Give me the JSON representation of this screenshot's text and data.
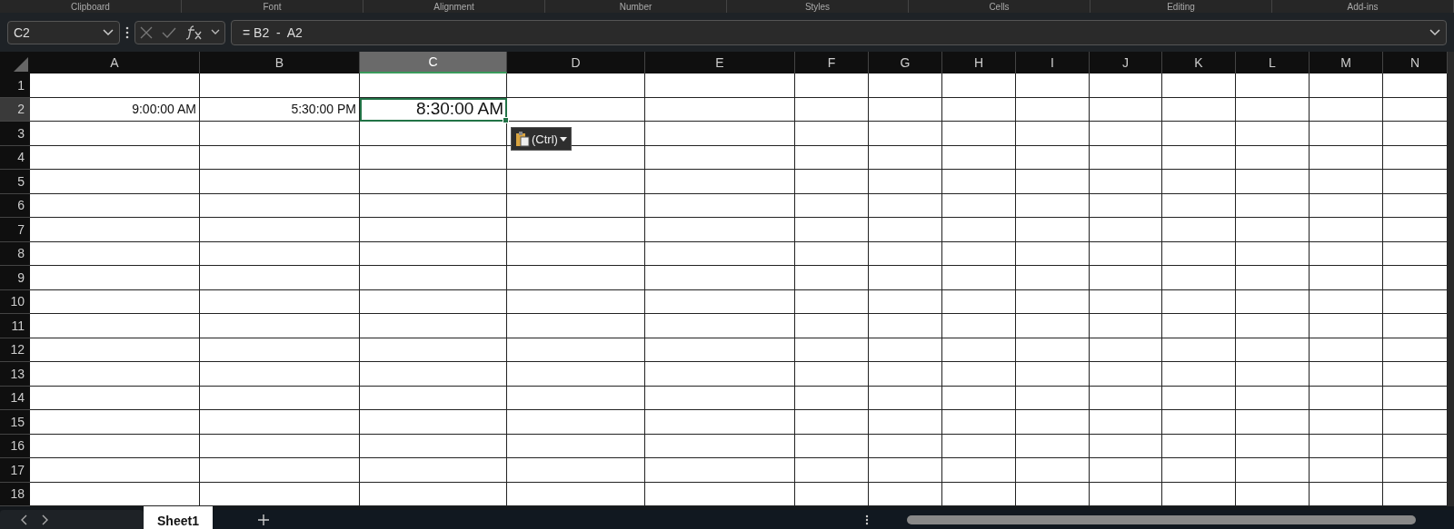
{
  "ribbon_groups": [
    "Clipboard",
    "Font",
    "Alignment",
    "Number",
    "Styles",
    "Cells",
    "Editing",
    "Add-ins"
  ],
  "name_box": {
    "value": "C2"
  },
  "formula_bar": {
    "value": "= B2  -  A2"
  },
  "columns": [
    {
      "label": "A",
      "selected": false
    },
    {
      "label": "B",
      "selected": false
    },
    {
      "label": "C",
      "selected": true
    },
    {
      "label": "D",
      "selected": false
    },
    {
      "label": "E",
      "selected": false
    },
    {
      "label": "F",
      "selected": false
    },
    {
      "label": "G",
      "selected": false
    },
    {
      "label": "H",
      "selected": false
    },
    {
      "label": "I",
      "selected": false
    },
    {
      "label": "J",
      "selected": false
    },
    {
      "label": "K",
      "selected": false
    },
    {
      "label": "L",
      "selected": false
    },
    {
      "label": "M",
      "selected": false
    },
    {
      "label": "N",
      "selected": false
    }
  ],
  "rows": [
    {
      "label": "1",
      "selected": false
    },
    {
      "label": "2",
      "selected": true,
      "cells": [
        "9:00:00 AM",
        "5:30:00 PM",
        "8:30:00 AM"
      ]
    },
    {
      "label": "3",
      "selected": false
    },
    {
      "label": "4",
      "selected": false
    },
    {
      "label": "5",
      "selected": false
    },
    {
      "label": "6",
      "selected": false
    },
    {
      "label": "7",
      "selected": false
    },
    {
      "label": "8",
      "selected": false
    },
    {
      "label": "9",
      "selected": false
    },
    {
      "label": "10",
      "selected": false
    },
    {
      "label": "11",
      "selected": false
    },
    {
      "label": "12",
      "selected": false
    },
    {
      "label": "13",
      "selected": false
    },
    {
      "label": "14",
      "selected": false
    },
    {
      "label": "15",
      "selected": false
    },
    {
      "label": "16",
      "selected": false
    },
    {
      "label": "17",
      "selected": false
    },
    {
      "label": "18",
      "selected": false
    }
  ],
  "paste_options": {
    "label": "(Ctrl)"
  },
  "sheet_tabs": [
    {
      "label": "Sheet1",
      "selected": true
    }
  ]
}
